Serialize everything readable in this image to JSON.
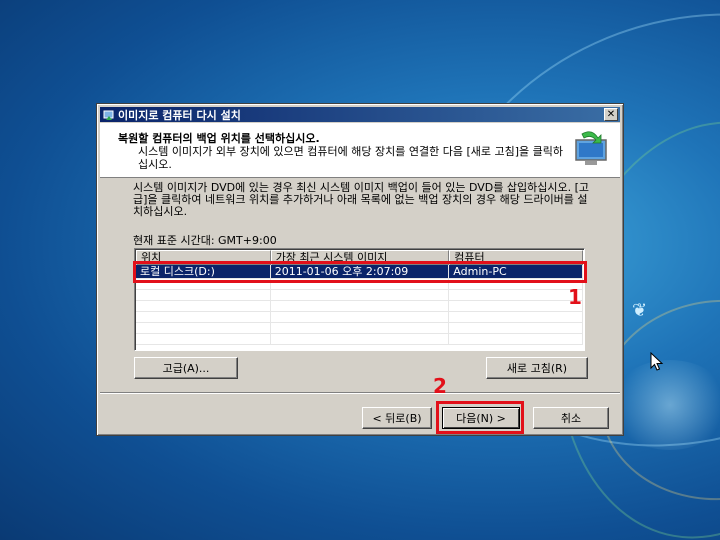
{
  "dialog": {
    "title": "이미지로 컴퓨터 다시 설치",
    "close_label": "✕",
    "header_title": "복원할 컴퓨터의 백업 위치를 선택하십시오.",
    "header_sub": "시스템 이미지가 외부 장치에 있으면 컴퓨터에 해당 장치를 연결한 다음 [새로 고침]을 클릭하십시오.",
    "description": "시스템 이미지가 DVD에 있는 경우 최신 시스템 이미지 백업이 들어 있는 DVD를 삽입하십시오. [고급]을 클릭하여 네트워크 위치를 추가하거나 아래 목록에 없는 백업 장치의 경우 해당 드라이버를 설치하십시오.",
    "timezone": "현재 표준 시간대: GMT+9:00"
  },
  "table": {
    "headers": [
      "위치",
      "가장 최근 시스템 이미지",
      "컴퓨터"
    ],
    "rows": [
      {
        "location": "로컬 디스크(D:)",
        "latest": "2011-01-06 오후 2:07:09",
        "computer": "Admin-PC"
      }
    ]
  },
  "buttons": {
    "advanced": "고급(A)...",
    "refresh": "새로 고침(R)",
    "back": "< 뒤로(B)",
    "next": "다음(N) >",
    "cancel": "취소"
  },
  "annotations": {
    "label_1": "1",
    "label_2": "2",
    "highlight_color": "#e2101a"
  },
  "icons": {
    "title_icon": "backup-restore-icon",
    "header_icon": "computer-restore-icon",
    "cursor": "mouse-pointer-icon"
  }
}
